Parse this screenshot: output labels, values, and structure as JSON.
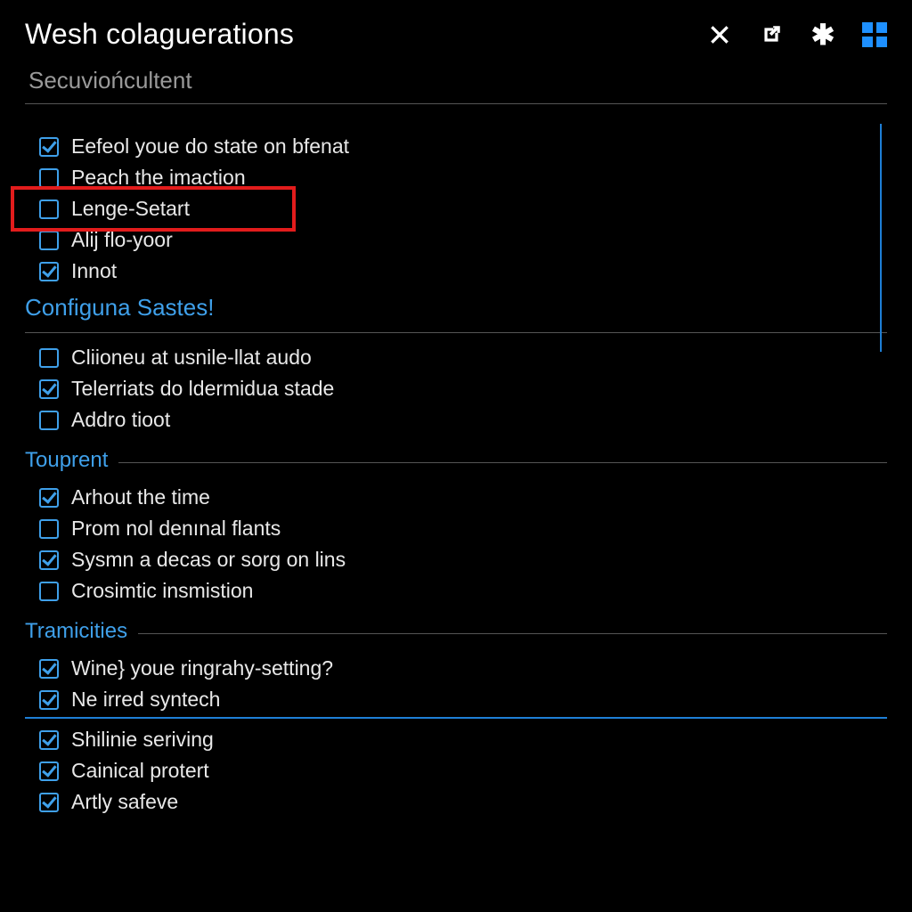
{
  "header": {
    "title": "Wesh colaguerations"
  },
  "subtitle": "Secuviońcultent",
  "colors": {
    "accent": "#3fa0ea",
    "highlight": "#e21c1c"
  },
  "section1": {
    "items": [
      {
        "label": "Eefeol youe do state on bfenat",
        "checked": true
      },
      {
        "label": "Peach the imaction",
        "checked": false
      },
      {
        "label": "Lenge-Setart",
        "checked": false,
        "highlighted": true
      },
      {
        "label": "Alij flo-yoor",
        "checked": false
      },
      {
        "label": "Innot",
        "checked": true
      }
    ]
  },
  "section2": {
    "title": "Configuna Sastes!",
    "items": [
      {
        "label": "Cliionеu at usnile-llat audo",
        "checked": false
      },
      {
        "label": "Telerriats do ldermiduа stade",
        "checked": true
      },
      {
        "label": "Addro tioot",
        "checked": false
      }
    ]
  },
  "section3": {
    "title": "Touprent",
    "items": [
      {
        "label": "Arhout the time",
        "checked": true
      },
      {
        "label": "Prom nol denınal flants",
        "checked": false
      },
      {
        "label": "Sysmn a decas or sorg on lins",
        "checked": true
      },
      {
        "label": "Crosimtic insmistion",
        "checked": false
      }
    ]
  },
  "section4": {
    "title": "Tramicities",
    "items": [
      {
        "label": "Wine} youe ringrahy-setting?",
        "checked": true
      },
      {
        "label": "Ne irred syntech",
        "checked": true
      },
      {
        "label": "Shilinie seriving",
        "checked": true
      },
      {
        "label": "Cainical protert",
        "checked": true
      },
      {
        "label": "Artly safeve",
        "checked": true
      }
    ]
  }
}
